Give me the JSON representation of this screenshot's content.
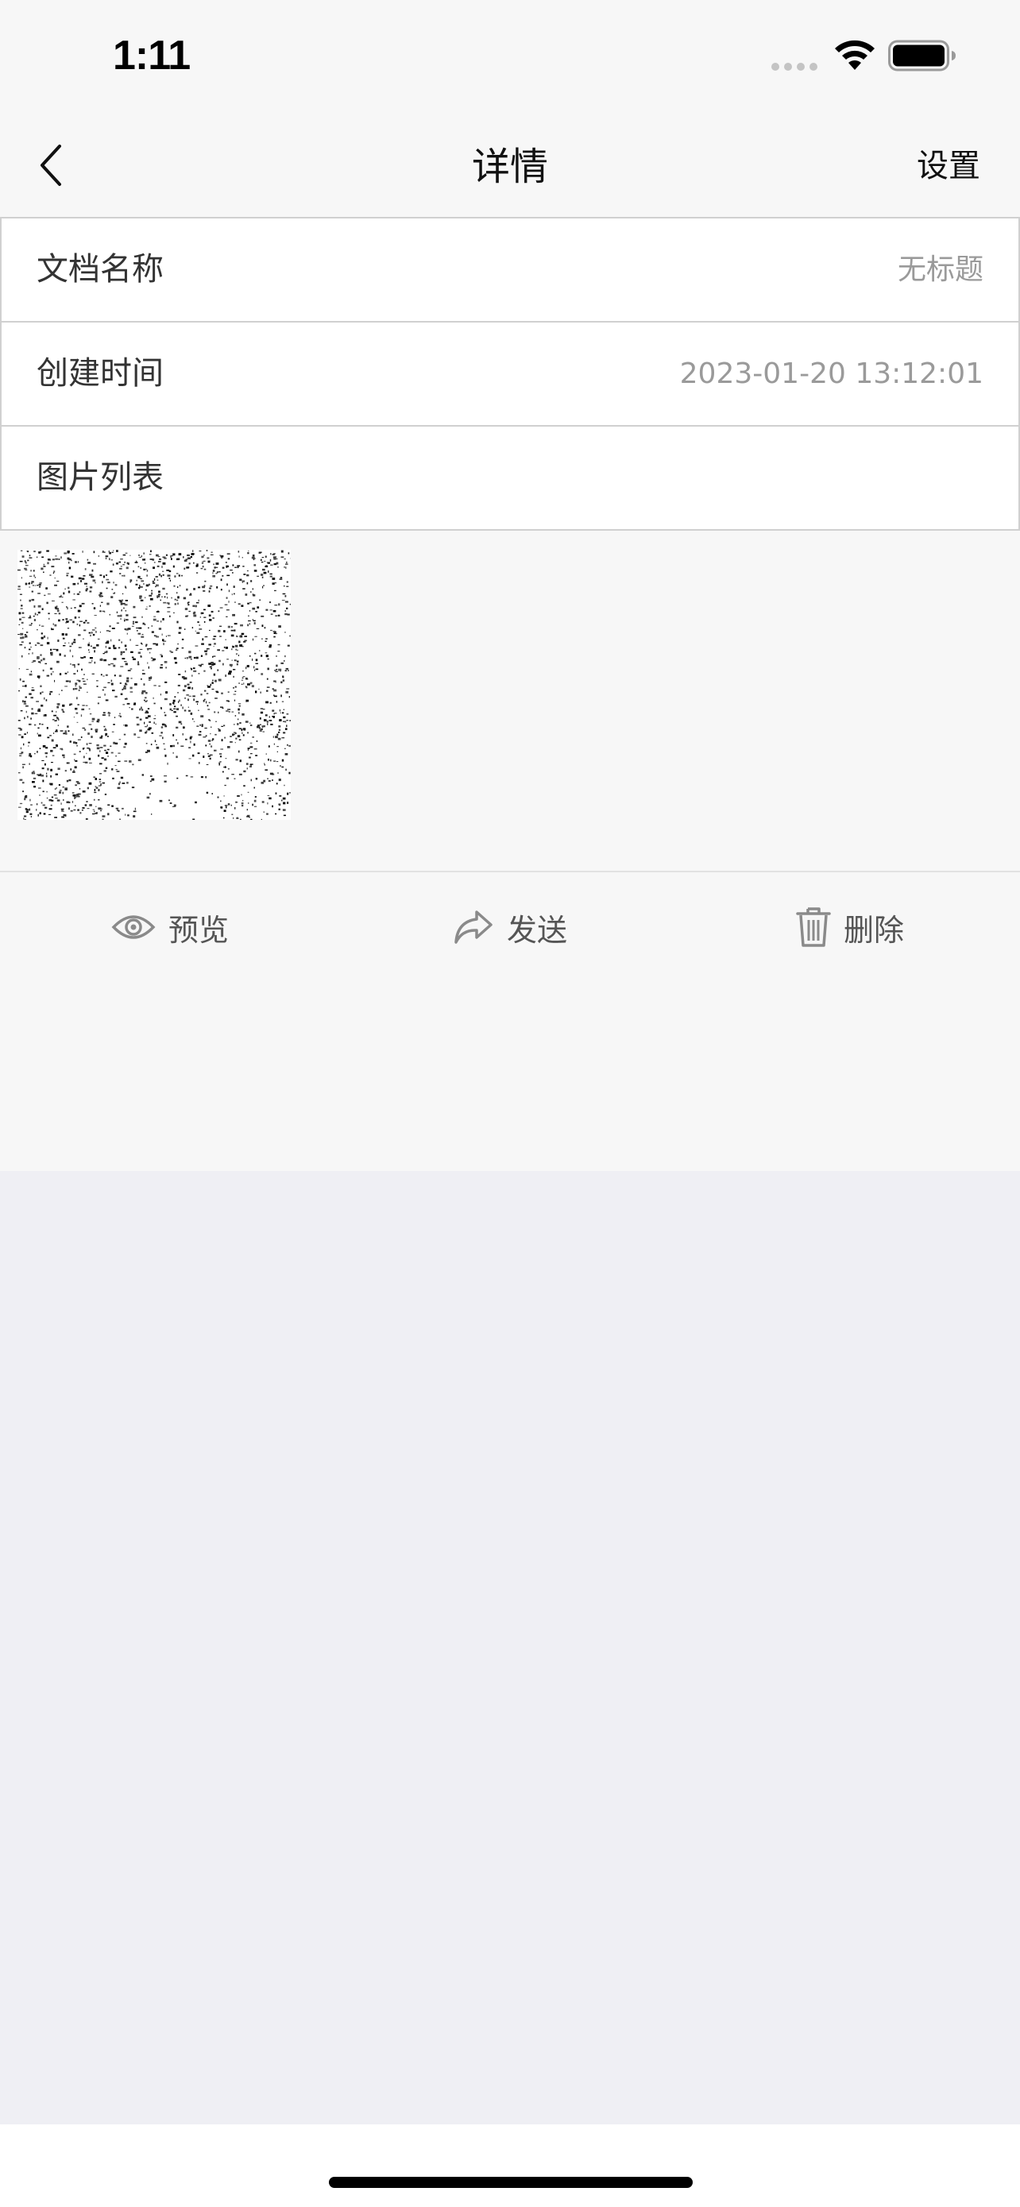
{
  "status_bar": {
    "time": "1:11"
  },
  "nav": {
    "title": "详情",
    "settings_label": "设置"
  },
  "info": {
    "rows": [
      {
        "label": "文档名称",
        "value": "无标题"
      },
      {
        "label": "创建时间",
        "value": "2023-01-20 13:12:01"
      },
      {
        "label": "图片列表",
        "value": ""
      }
    ]
  },
  "actions": {
    "preview_label": "预览",
    "send_label": "发送",
    "delete_label": "删除"
  },
  "icons": {
    "back": "chevron-left-icon",
    "preview": "eye-icon",
    "send": "share-arrow-icon",
    "delete": "trash-icon"
  },
  "colors": {
    "nav_background": "#f7f7f7",
    "page_background": "#efeff4",
    "row_border": "#d0d0d0",
    "value_text": "#9a9a9a",
    "action_icon": "#8a8a8a"
  }
}
